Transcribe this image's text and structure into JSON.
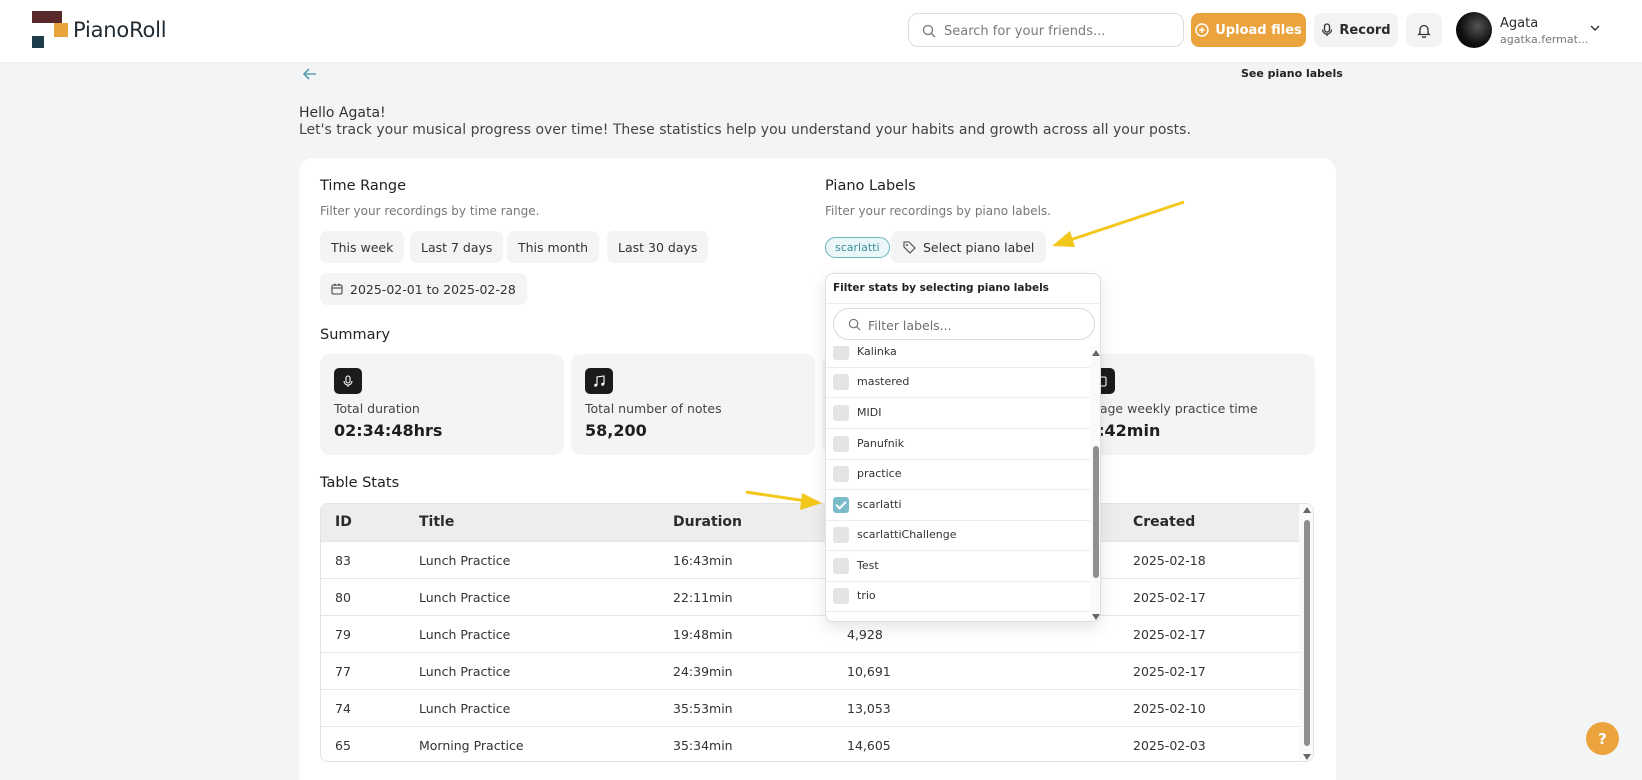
{
  "brand": {
    "name": "PianoRoll"
  },
  "header": {
    "search_placeholder": "Search for your friends...",
    "upload_label": "Upload files",
    "record_label": "Record",
    "user_name": "Agata",
    "user_email": "agatka.fermat..."
  },
  "top": {
    "see_labels": "See piano labels"
  },
  "intro": {
    "hello": "Hello Agata!",
    "text": "Let's track your musical progress over time! These statistics help you understand your habits and growth across all your posts."
  },
  "time_range": {
    "title": "Time Range",
    "subtitle": "Filter your recordings by time range.",
    "chips": [
      "This week",
      "Last 7 days",
      "This month",
      "Last 30 days"
    ],
    "date_range": "2025-02-01 to 2025-02-28"
  },
  "piano_labels": {
    "title": "Piano Labels",
    "subtitle": "Filter your recordings by piano labels.",
    "selected": [
      "scarlatti"
    ],
    "select_label": "Select piano label"
  },
  "summary": {
    "title": "Summary",
    "cards": [
      {
        "label": "Total duration",
        "value": "02:34:48hrs",
        "icon": "mic-icon"
      },
      {
        "label": "Total number of notes",
        "value": "58,200",
        "icon": "music-note-icon"
      },
      {
        "label": "",
        "value": "",
        "icon": ""
      },
      {
        "label": "erage weekly practice time",
        "value": "3:42min",
        "icon": "calendar-icon"
      }
    ]
  },
  "table": {
    "title": "Table Stats",
    "headers": {
      "id": "ID",
      "title": "Title",
      "duration": "Duration",
      "created": "Created"
    },
    "rows": [
      {
        "id": "83",
        "title": "Lunch Practice",
        "duration": "16:43min",
        "notes": "",
        "created": "2025-02-18"
      },
      {
        "id": "80",
        "title": "Lunch Practice",
        "duration": "22:11min",
        "notes": "",
        "created": "2025-02-17"
      },
      {
        "id": "79",
        "title": "Lunch Practice",
        "duration": "19:48min",
        "notes": "4,928",
        "created": "2025-02-17"
      },
      {
        "id": "77",
        "title": "Lunch Practice",
        "duration": "24:39min",
        "notes": "10,691",
        "created": "2025-02-17"
      },
      {
        "id": "74",
        "title": "Lunch Practice",
        "duration": "35:53min",
        "notes": "13,053",
        "created": "2025-02-10"
      },
      {
        "id": "65",
        "title": "Morning Practice",
        "duration": "35:34min",
        "notes": "14,605",
        "created": "2025-02-03"
      }
    ]
  },
  "dropdown": {
    "title": "Filter stats by selecting piano labels",
    "search_placeholder": "Filter labels...",
    "items": [
      {
        "label": "Kalinka",
        "checked": false
      },
      {
        "label": "mastered",
        "checked": false
      },
      {
        "label": "MIDI",
        "checked": false
      },
      {
        "label": "Panufnik",
        "checked": false
      },
      {
        "label": "practice",
        "checked": false
      },
      {
        "label": "scarlatti",
        "checked": true
      },
      {
        "label": "scarlattiChallenge",
        "checked": false
      },
      {
        "label": "Test",
        "checked": false
      },
      {
        "label": "trio",
        "checked": false
      }
    ]
  },
  "help": {
    "label": "?"
  },
  "colors": {
    "accent": "#eba33d",
    "label_teal": "#6bb6c2",
    "arrow": "#f3c61b"
  }
}
